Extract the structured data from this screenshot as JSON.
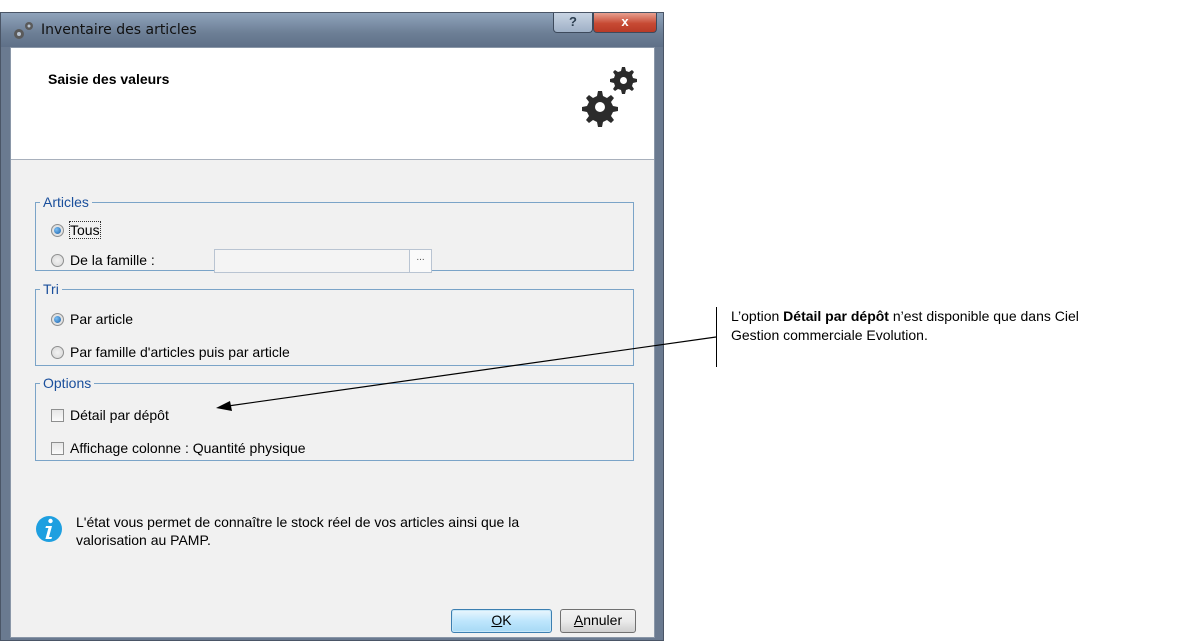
{
  "window": {
    "title": "Inventaire des articles",
    "help_label": "?",
    "close_label": "x"
  },
  "header": {
    "title": "Saisie des valeurs"
  },
  "articles": {
    "legend": "Articles",
    "option_tous": "Tous",
    "option_famille": "De la famille :",
    "famille_value": "",
    "browse_label": "...",
    "selected": "Tous"
  },
  "tri": {
    "legend": "Tri",
    "option_article": "Par article",
    "option_famille": "Par famille d'articles puis par article",
    "selected": "Par article"
  },
  "options": {
    "legend": "Options",
    "detail_depot": "Détail par dépôt",
    "detail_depot_checked": false,
    "affichage_colonne": "Affichage colonne : Quantité physique",
    "affichage_colonne_checked": false
  },
  "info": {
    "line1": "L'état vous permet de connaître le stock réel de vos articles ainsi que la",
    "line2": "valorisation au PAMP."
  },
  "buttons": {
    "ok_mnemonic": "O",
    "ok_rest": "K",
    "cancel_mnemonic": "A",
    "cancel_rest": "nnuler"
  },
  "annotation": {
    "prefix": "L’option ",
    "bold": "Détail par dépôt",
    "suffix": " n’est disponible que dans Ciel",
    "line2": "Gestion commerciale Evolution."
  },
  "colors": {
    "legend_text": "#1a4f9c",
    "group_border": "#7ba4c8",
    "info_icon": "#1e9fe0",
    "ok_border": "#3c7fb1"
  }
}
